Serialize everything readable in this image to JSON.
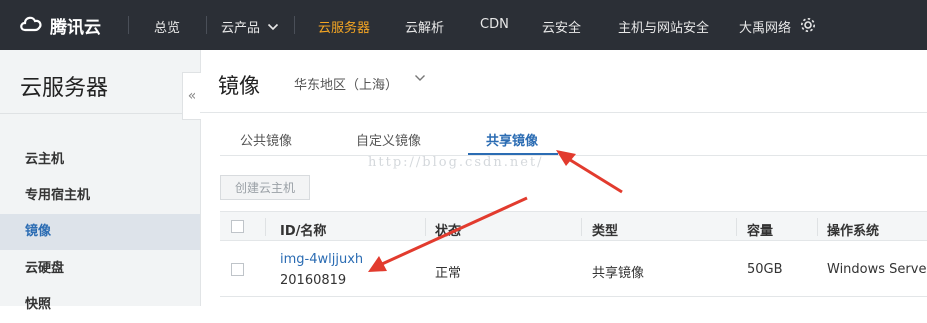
{
  "topbar": {
    "brand": "腾讯云",
    "nav": [
      {
        "label": "总览"
      },
      {
        "label": "云产品"
      },
      {
        "label": "云服务器"
      },
      {
        "label": "云解析"
      },
      {
        "label": "CDN"
      },
      {
        "label": "云安全"
      },
      {
        "label": "主机与网站安全"
      },
      {
        "label": "大禹网络"
      }
    ],
    "active_nav": "云服务器",
    "active_color": "#f5a623"
  },
  "sidebar": {
    "title": "云服务器",
    "collapse_icon": "«",
    "items": [
      {
        "label": "云主机"
      },
      {
        "label": "专用宿主机"
      },
      {
        "label": "镜像"
      },
      {
        "label": "云硬盘"
      },
      {
        "label": "快照"
      }
    ],
    "active_item": "镜像"
  },
  "main": {
    "title": "镜像",
    "region": "华东地区（上海）",
    "tabs": [
      {
        "label": "公共镜像"
      },
      {
        "label": "自定义镜像"
      },
      {
        "label": "共享镜像"
      }
    ],
    "active_tab": "共享镜像",
    "watermark": "http://blog.csdn.net/",
    "create_button": "创建云主机",
    "table": {
      "headers": [
        "ID/名称",
        "状态",
        "类型",
        "容量",
        "操作系统"
      ],
      "rows": [
        {
          "id": "img-4wljjuxh",
          "name": "20160819",
          "status": "正常",
          "type": "共享镜像",
          "capacity": "50GB",
          "os": "Windows Server"
        }
      ]
    }
  },
  "colors": {
    "topbar_bg": "#2b2f36",
    "accent_blue": "#2b6cb3",
    "annotation_red": "#e23b2e"
  }
}
